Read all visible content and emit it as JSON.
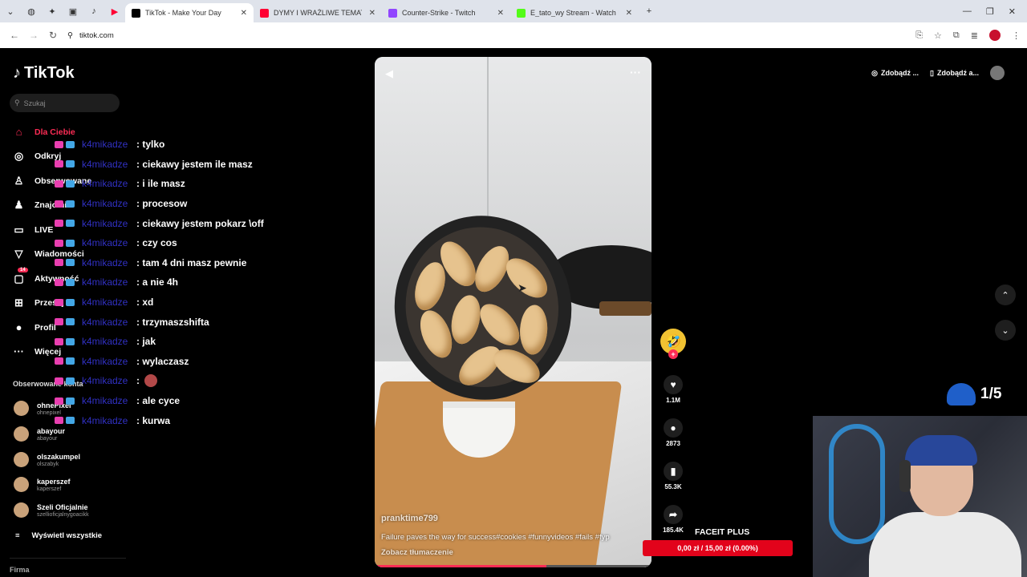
{
  "browser": {
    "tabs": [
      {
        "label": "TikTok - Make Your Day",
        "active": true,
        "color": "#000000"
      },
      {
        "label": "DYMY I WRAŻLIWE TEMATY N...",
        "active": false,
        "color": "#ff0033"
      },
      {
        "label": "Counter-Strike - Twitch",
        "active": false,
        "color": "#9146ff"
      },
      {
        "label": "E_tato_wy Stream - Watch Live",
        "active": false,
        "color": "#53fc18"
      }
    ],
    "new_tab": "+",
    "url": "tiktok.com"
  },
  "sidebar": {
    "logo": "TikTok",
    "search_placeholder": "Szukaj",
    "nav": [
      {
        "label": "Dla Ciebie",
        "icon": "home-icon",
        "glyph": "⌂",
        "active": true
      },
      {
        "label": "Odkryj",
        "icon": "compass-icon",
        "glyph": "◎"
      },
      {
        "label": "Obserwowane",
        "icon": "follow-icon",
        "glyph": "♙"
      },
      {
        "label": "Znajomi",
        "icon": "friends-icon",
        "glyph": "♟"
      },
      {
        "label": "LIVE",
        "icon": "live-icon",
        "glyph": "▭"
      },
      {
        "label": "Wiadomości",
        "icon": "messages-icon",
        "glyph": "▽"
      },
      {
        "label": "Aktywność",
        "icon": "activity-icon",
        "glyph": "▢",
        "badge": "14"
      },
      {
        "label": "Prześlij",
        "icon": "upload-icon",
        "glyph": "⊞"
      },
      {
        "label": "Profil",
        "icon": "profile-icon",
        "glyph": "●"
      },
      {
        "label": "Więcej",
        "icon": "more-icon",
        "glyph": "···"
      }
    ],
    "following_title": "Obserwowane konta",
    "accounts": [
      {
        "name": "ohnePixel",
        "handle": "ohnepixel"
      },
      {
        "name": "abayour",
        "handle": "abayour"
      },
      {
        "name": "olszakumpel",
        "handle": "olszabyk"
      },
      {
        "name": "kaperszef",
        "handle": "kaperszef"
      },
      {
        "name": "Szeli Oficjalnie",
        "handle": "szellioficjalnygoacikk"
      }
    ],
    "show_all": "Wyświetl wszystkie",
    "footer": "Firma"
  },
  "chat": {
    "user": "k4mikadze",
    "messages": [
      ": tylko",
      ": ciekawy jestem ile masz",
      ": i ile masz",
      ": procesow",
      ": ciekawy jestem pokarz \\off",
      ": czy cos",
      ": tam 4 dni masz pewnie",
      ": a nie 4h",
      ": xd",
      ": trzymaszshifta",
      ": jak",
      ": wylaczasz",
      ": ",
      ": ale cyce",
      ": kurwa"
    ]
  },
  "video": {
    "author": "pranktime799",
    "description": "Failure paves the way for success#cookies #funnyvideos #fails #fyp",
    "translate": "Zobacz tłumaczenie",
    "progress": 0.62
  },
  "actions": {
    "likes": "1.1M",
    "comments": "2873",
    "saves": "55.3K",
    "shares": "185.4K"
  },
  "topbar": {
    "btn1": "Zdobądź ...",
    "btn2": "Zdobądź a..."
  },
  "overlay": {
    "counter": "1/5",
    "faceit_title": "FACEIT PLUS",
    "faceit_amount": "0,00 zł / 15,00 zł (0.00%)"
  }
}
